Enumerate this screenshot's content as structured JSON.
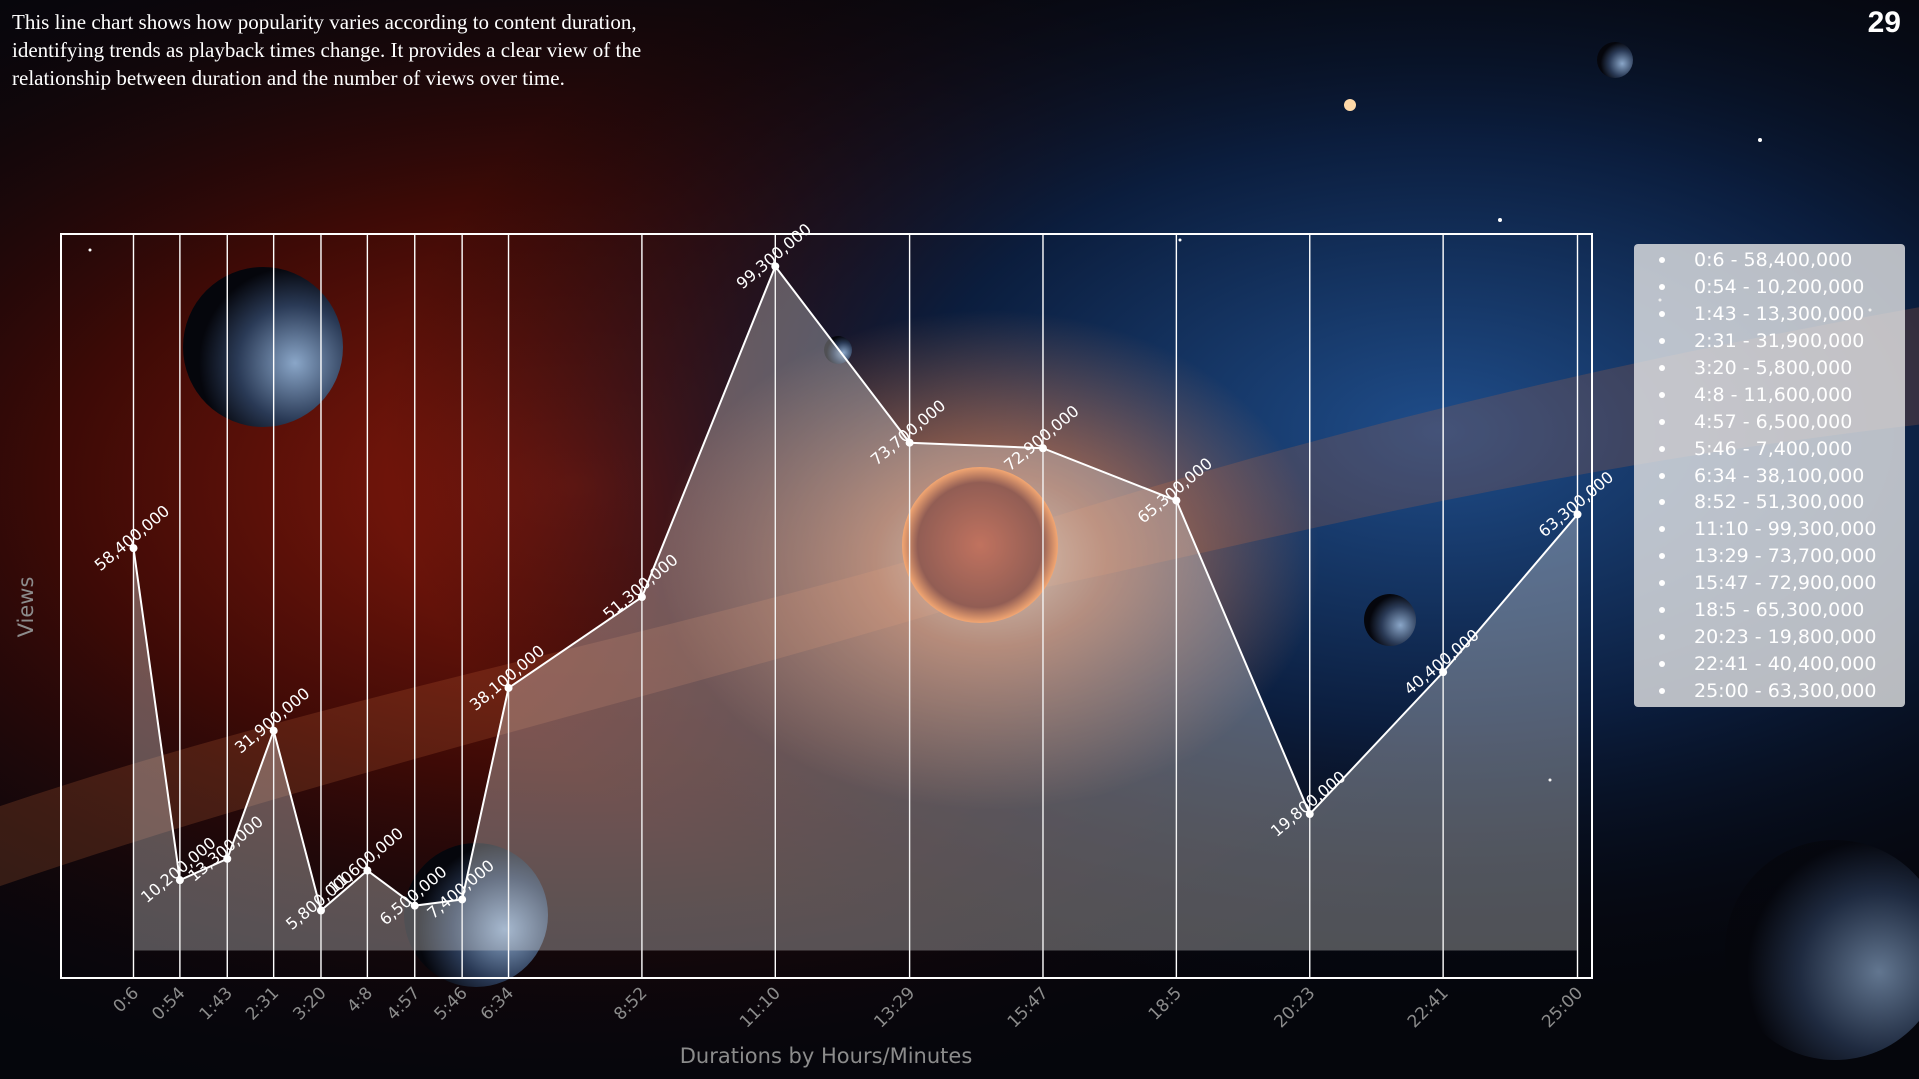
{
  "description": "This line chart shows how popularity varies according to content duration, identifying trends as playback times change. It provides a clear view of the relationship between duration and the number of views over time.",
  "page_number": "29",
  "colors": {
    "line": "#ffffff",
    "fill": "rgba(220,220,220,0.35)",
    "legend_background": "#ebebeb",
    "axis_text": "#8c8c8c"
  },
  "legend": [
    {
      "label": "0:6 - 58,400,000"
    },
    {
      "label": "0:54 - 10,200,000"
    },
    {
      "label": "1:43 - 13,300,000"
    },
    {
      "label": "2:31 - 31,900,000"
    },
    {
      "label": "3:20 - 5,800,000"
    },
    {
      "label": "4:8 - 11,600,000"
    },
    {
      "label": "4:57 - 6,500,000"
    },
    {
      "label": "5:46 - 7,400,000"
    },
    {
      "label": "6:34 - 38,100,000"
    },
    {
      "label": "8:52 - 51,300,000"
    },
    {
      "label": "11:10 - 99,300,000"
    },
    {
      "label": "13:29 - 73,700,000"
    },
    {
      "label": "15:47 - 72,900,000"
    },
    {
      "label": "18:5 - 65,300,000"
    },
    {
      "label": "20:23 - 19,800,000"
    },
    {
      "label": "22:41 - 40,400,000"
    },
    {
      "label": "25:00 - 63,300,000"
    }
  ],
  "chart_data": {
    "type": "area",
    "title": "",
    "xlabel": "Durations by Hours/Minutes",
    "ylabel": "Views",
    "categories": [
      "0:6",
      "0:54",
      "1:43",
      "2:31",
      "3:20",
      "4:8",
      "4:57",
      "5:46",
      "6:34",
      "8:52",
      "11:10",
      "13:29",
      "15:47",
      "18:5",
      "20:23",
      "22:41",
      "25:00"
    ],
    "x_minutes": [
      0.1,
      0.9,
      1.717,
      2.517,
      3.333,
      4.133,
      4.95,
      5.767,
      6.567,
      8.867,
      11.167,
      13.483,
      15.783,
      18.083,
      20.383,
      22.683,
      25.0
    ],
    "values": [
      58400000,
      10200000,
      13300000,
      31900000,
      5800000,
      11600000,
      6500000,
      7400000,
      38100000,
      51300000,
      99300000,
      73700000,
      72900000,
      65300000,
      19800000,
      40400000,
      63300000
    ],
    "data_labels": [
      "58,400,000",
      "10,200,000",
      "13,300,000",
      "31,900,000",
      "5,800,000",
      "11,600,000",
      "6,500,000",
      "7,400,000",
      "38,100,000",
      "51,300,000",
      "99,300,000",
      "73,700,000",
      "72,900,000",
      "65,300,000",
      "19,800,000",
      "40,400,000",
      "63,300,000"
    ],
    "xlim": [
      -1.15,
      25.25
    ],
    "ylim": [
      -4000000,
      104000000
    ],
    "fill_baseline": 0,
    "grid": "vertical lines at each category",
    "legend_position": "right"
  }
}
